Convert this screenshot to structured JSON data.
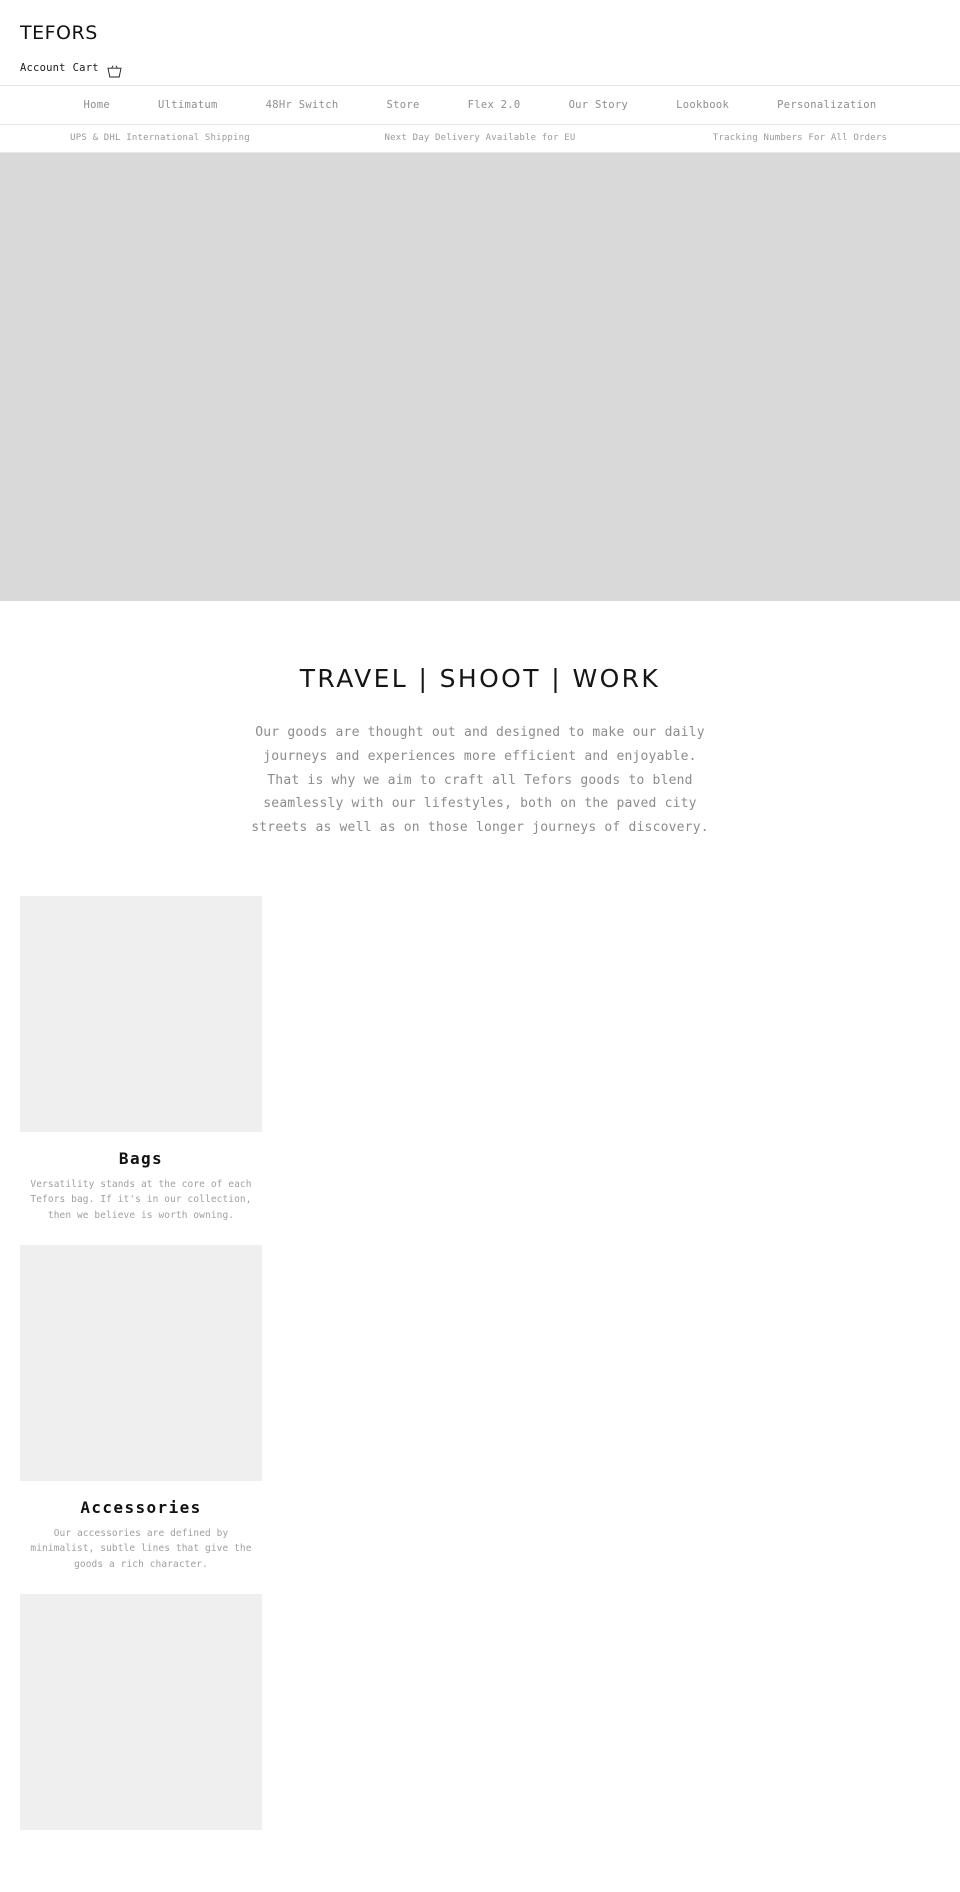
{
  "header": {
    "brand": "TEFORS",
    "account_label": "Account",
    "cart_label": "Cart",
    "cart_icon": "shopping-basket-icon"
  },
  "nav": {
    "items": [
      {
        "label": "Home"
      },
      {
        "label": "Ultimatum"
      },
      {
        "label": "48Hr Switch"
      },
      {
        "label": "Store"
      },
      {
        "label": "Flex 2.0"
      },
      {
        "label": "Our Story"
      },
      {
        "label": "Lookbook"
      },
      {
        "label": "Personalization"
      }
    ]
  },
  "announcements": [
    {
      "text": "UPS & DHL International Shipping"
    },
    {
      "text": "Next Day Delivery Available for EU"
    },
    {
      "text": "Tracking Numbers For All Orders"
    }
  ],
  "hero": {
    "placeholder_color": "#d9d9d9"
  },
  "intro": {
    "heading": "TRAVEL  |  SHOOT  |  WORK",
    "body": "Our goods are thought out and designed to make our daily journeys and experiences more efficient and enjoyable. That is why we aim to craft all Tefors goods to blend seamlessly with our lifestyles, both on the paved city streets as well as on those longer journeys of discovery."
  },
  "categories": [
    {
      "title": "Bags",
      "description": "Versatility stands at the core of each Tefors bag. If it's in our collection, then we believe is worth owning."
    },
    {
      "title": "Accessories",
      "description": "Our accessories are defined by minimalist, subtle lines that give the goods a rich character."
    },
    {
      "title": "",
      "description": ""
    }
  ],
  "colors": {
    "text_primary": "#121212",
    "text_muted": "#8e8e8e",
    "card_placeholder": "#efefef",
    "hero_placeholder": "#d9d9d9",
    "border": "#e8e8e8"
  }
}
